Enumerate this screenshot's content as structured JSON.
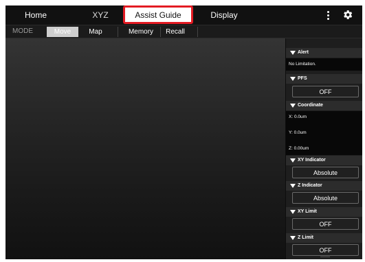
{
  "nav": {
    "tabs": [
      "Home",
      "XYZ",
      "Assist Guide",
      "Display"
    ],
    "active_tab": "XYZ",
    "highlighted_tab": "Assist Guide",
    "highlight_color": "#e31b23"
  },
  "modebar": {
    "label": "MODE",
    "buttons": [
      "Move",
      "Map",
      "Memory",
      "Recall"
    ],
    "selected": "Move"
  },
  "panel": {
    "alert": {
      "title": "Alert",
      "text": "No Limitation."
    },
    "pfs": {
      "title": "PFS",
      "value": "OFF"
    },
    "coordinate": {
      "title": "Coordinate",
      "x": "X: 0.0um",
      "y": "Y: 0.0um",
      "z": "Z: 0.00um"
    },
    "xy_indicator": {
      "title": "XY Indicator",
      "value": "Absolute"
    },
    "z_indicator": {
      "title": "Z Indicator",
      "value": "Absolute"
    },
    "xy_limit": {
      "title": "XY Limit",
      "value": "OFF"
    },
    "z_limit": {
      "title": "Z Limit",
      "value": "OFF"
    }
  },
  "icons": {
    "menu": "kebab-menu-icon",
    "settings": "gear-icon"
  }
}
